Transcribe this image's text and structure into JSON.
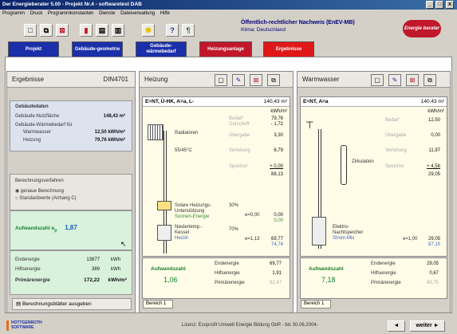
{
  "window": {
    "title": "Der Energieberater 5.00  -  Projekt Nr.4  -  softwaretest DAB",
    "btn_min": "_",
    "btn_max": "□",
    "btn_close": "x"
  },
  "menu": [
    "Programm",
    "Druck",
    "Programmkonstanten",
    "Dienste",
    "Dateiverwaltung",
    "Hilfe"
  ],
  "header": {
    "title": "Öffentlich-rechtlicher Nachweis (EnEV-MB)",
    "subtitle": "Klima: Deutschland",
    "logo": "Energie berater"
  },
  "tabs": [
    {
      "label": "Projekt",
      "color": "#1a2fa8"
    },
    {
      "label": "Gebäude-geometrie",
      "color": "#1a2fa8"
    },
    {
      "label": "Gebäude-wärmebedarf",
      "color": "#1a2fa8"
    },
    {
      "label": "Heizungsanlage",
      "color": "#c0182a"
    },
    {
      "label": "Ergebnisse",
      "color": "#e01818"
    }
  ],
  "ergebnisse": {
    "title": "Ergebnisse",
    "norm": "DIN4701",
    "gebaeudedaten": {
      "heading": "Gebäudedaten",
      "nutz_label": "Gebäude-Nutzfläche",
      "nutz_value": "148,43 m²",
      "wb_label": "Gebäude-Wärmebedarf für",
      "warm_label": "Warmwasser",
      "warm_value": "12,50 kWh/m²",
      "heiz_label": "Heizung",
      "heiz_value": "79,76 kWh/m²"
    },
    "verfahren": {
      "heading": "Berechnungsverfahren",
      "opt1": "genaue Berechnung",
      "opt2": "Standardwerte (Anhang C)"
    },
    "aufwand": {
      "label": "Aufwandszahl e",
      "sub": "p",
      "value": "1,87"
    },
    "energie": [
      {
        "label": "Endenergie",
        "value": "13877",
        "unit": "kWh"
      },
      {
        "label": "Hilfsenergie",
        "value": "389",
        "unit": "kWh"
      },
      {
        "label": "Primärenergie",
        "value": "172,22",
        "unit": "kWh/m²"
      }
    ],
    "button": "Berechnungsblätter ausgeben"
  },
  "heizung": {
    "title": "Heizung",
    "formula": "E=NT, Ü-HK, A=a, L-",
    "area": "140,43 m²",
    "unit_col": "kWh/m²",
    "keys": [
      "Bedarf",
      "Gutschrift",
      "Übergabe",
      "Verteilung",
      "Speicher"
    ],
    "vals": [
      "79,76",
      "- 1,72",
      "3,30",
      "6,79",
      "+ 0,00"
    ],
    "sum": "88,13",
    "radiator": "Radiatoren",
    "temp": "55/45°C",
    "gen": [
      {
        "lines": [
          "Solare Heizungs-",
          "Unterstützung"
        ],
        "sub": "Sonnen-Energie",
        "pct": "30%",
        "e": "e=0,00",
        "v1": "0,00",
        "v2": "0,00"
      },
      {
        "lines": [
          "Niedertemp.-",
          "Kessel"
        ],
        "sub": "Heizöl",
        "pct": "70%",
        "e": "e=1,13",
        "v1": "69,77",
        "v2": "74,74"
      }
    ],
    "aufwand_label": "Aufwandszahl",
    "aufwand_value": "1,06",
    "bottom": [
      {
        "label": "Endenergie",
        "value": "69,77"
      },
      {
        "label": "Hilfsenergie",
        "value": "1,91"
      },
      {
        "label": "Primärenergie",
        "value": "82,47"
      }
    ],
    "bereich": "Bereich 1"
  },
  "warm": {
    "title": "Warmwasser",
    "formula": "E=NT, A=a",
    "area": "140,43 m²",
    "unit_col": "kWh/m²",
    "keys": [
      "Bedarf",
      "Übergabe",
      "Verteilung",
      "Speicher"
    ],
    "vals": [
      "12,50",
      "0,00",
      "11,97",
      "+ 4,58"
    ],
    "sum": "29,05",
    "zirk": "Zirkulation",
    "gen": {
      "lines": [
        "Elektro-",
        "Nachtspeicher"
      ],
      "sub": "Strom-Mix",
      "e": "e=1,00",
      "v1": "29,05",
      "v2": "87,15"
    },
    "aufwand_label": "Aufwandszahl",
    "aufwand_value": "7,18",
    "bottom": [
      {
        "label": "Endenergie",
        "value": "29,05"
      },
      {
        "label": "Hilfsenergie",
        "value": "0,67"
      },
      {
        "label": "Primärenergie",
        "value": "89,75"
      }
    ],
    "bereich": "Bereich 1"
  },
  "footer": {
    "brand": "HOTTGENROTH SOFTWARE",
    "license": "Lizenz: Ecoprofit Umwelt Energie Bildung GbR - bis 30.06.2004-",
    "back": "◄",
    "next": "weiter ►"
  }
}
